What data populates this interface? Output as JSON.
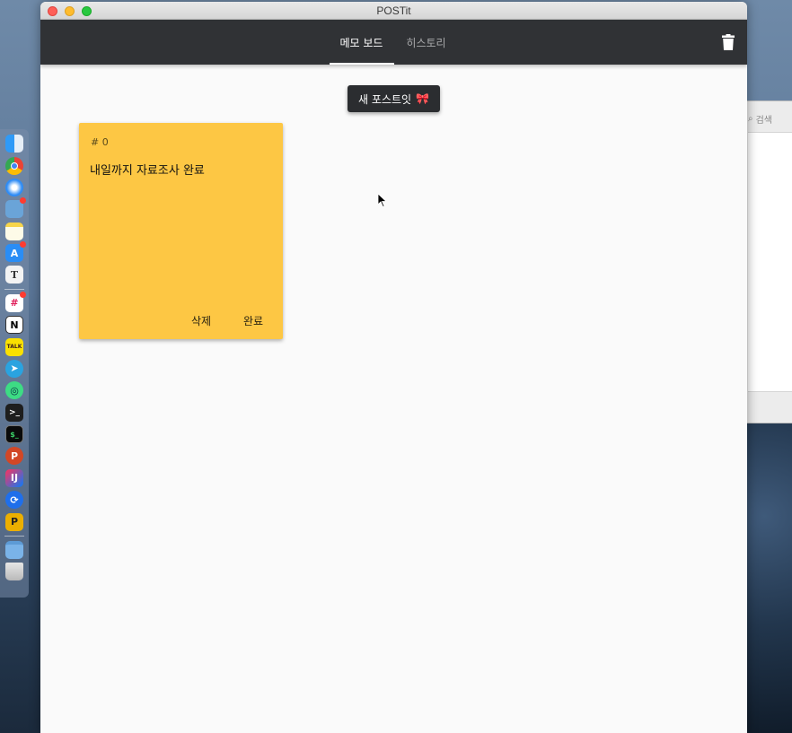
{
  "window": {
    "title": "POSTit"
  },
  "tabs": [
    {
      "label": "메모 보드",
      "active": true
    },
    {
      "label": "히스토리",
      "active": false
    }
  ],
  "toolbar": {
    "trash_icon": "trash-icon"
  },
  "new_button": {
    "label": "새 포스트잇",
    "emoji": "🎀"
  },
  "notes": [
    {
      "number": "# 0",
      "content": "내일까지 자료조사 완료",
      "delete_label": "삭제",
      "done_label": "완료",
      "color": "#fdc744"
    }
  ],
  "background_window": {
    "search_placeholder": "검색"
  },
  "colors": {
    "appbar": "#303235",
    "note": "#fdc744",
    "button": "#2b2d30"
  },
  "dock": {
    "icons": [
      "finder-icon",
      "chrome-icon",
      "safari-icon",
      "preview-icon",
      "notes-icon",
      "app-store-icon",
      "typora-icon",
      "slack-icon",
      "notion-icon",
      "kakaotalk-icon",
      "telegram-icon",
      "android-studio-icon",
      "terminal-icon",
      "iterm-icon",
      "powerpoint-icon",
      "intellij-icon",
      "github-desktop-icon",
      "plex-icon",
      "folder-icon",
      "trash-bin-icon"
    ]
  }
}
